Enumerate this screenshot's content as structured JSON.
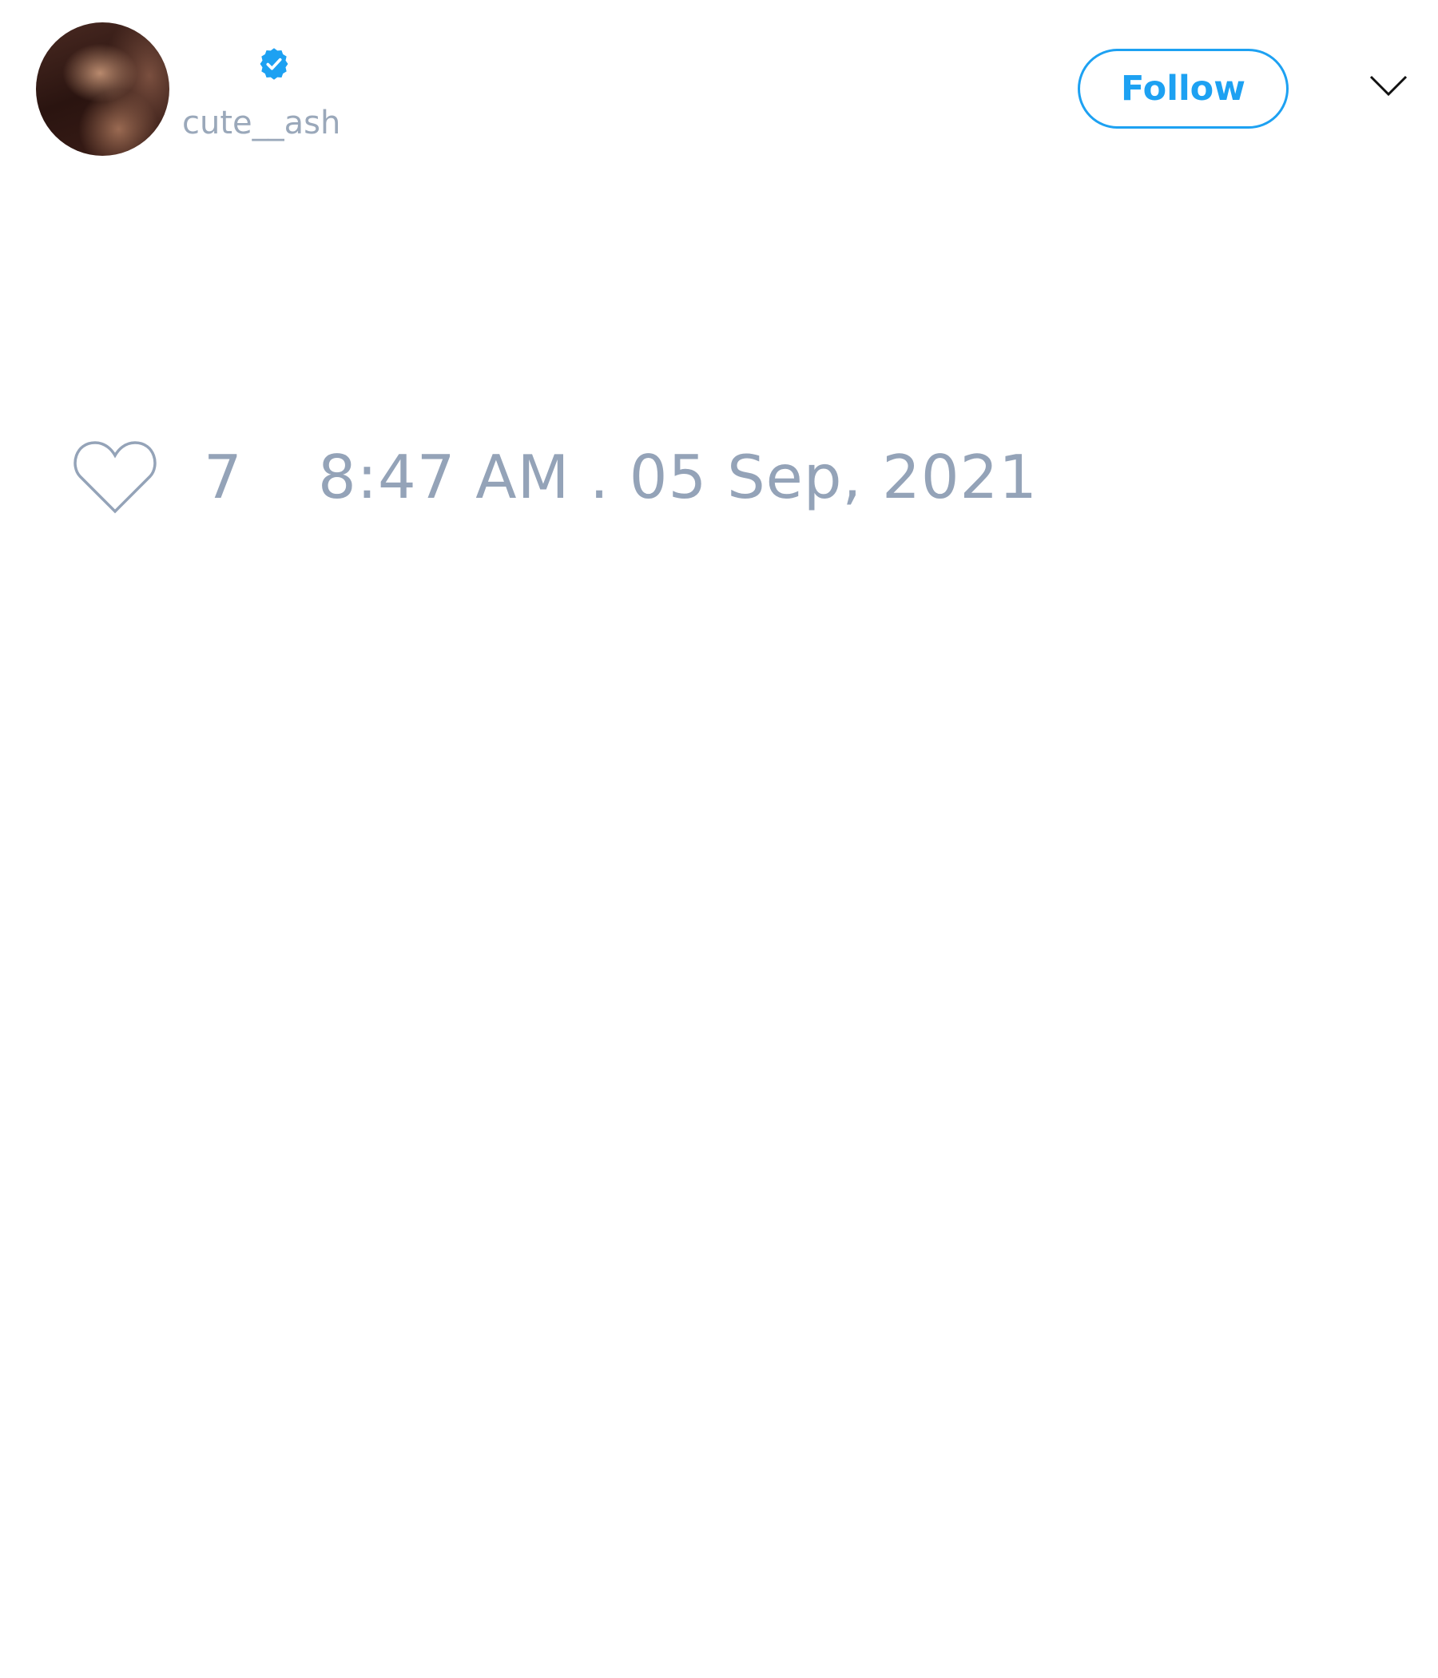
{
  "tweet": {
    "author": {
      "handle": "cute__ash",
      "verified": true,
      "avatar": "profile-photo"
    },
    "follow_label": "Follow",
    "like_count": "7",
    "timestamp": "8:47 AM . 05 Sep, 2021"
  },
  "icons": {
    "verified": "verified-badge-icon",
    "menu": "chevron-down-icon",
    "like": "heart-icon"
  },
  "colors": {
    "accent": "#1da1f2",
    "muted_text": "#94a3b8",
    "background": "#ffffff"
  }
}
